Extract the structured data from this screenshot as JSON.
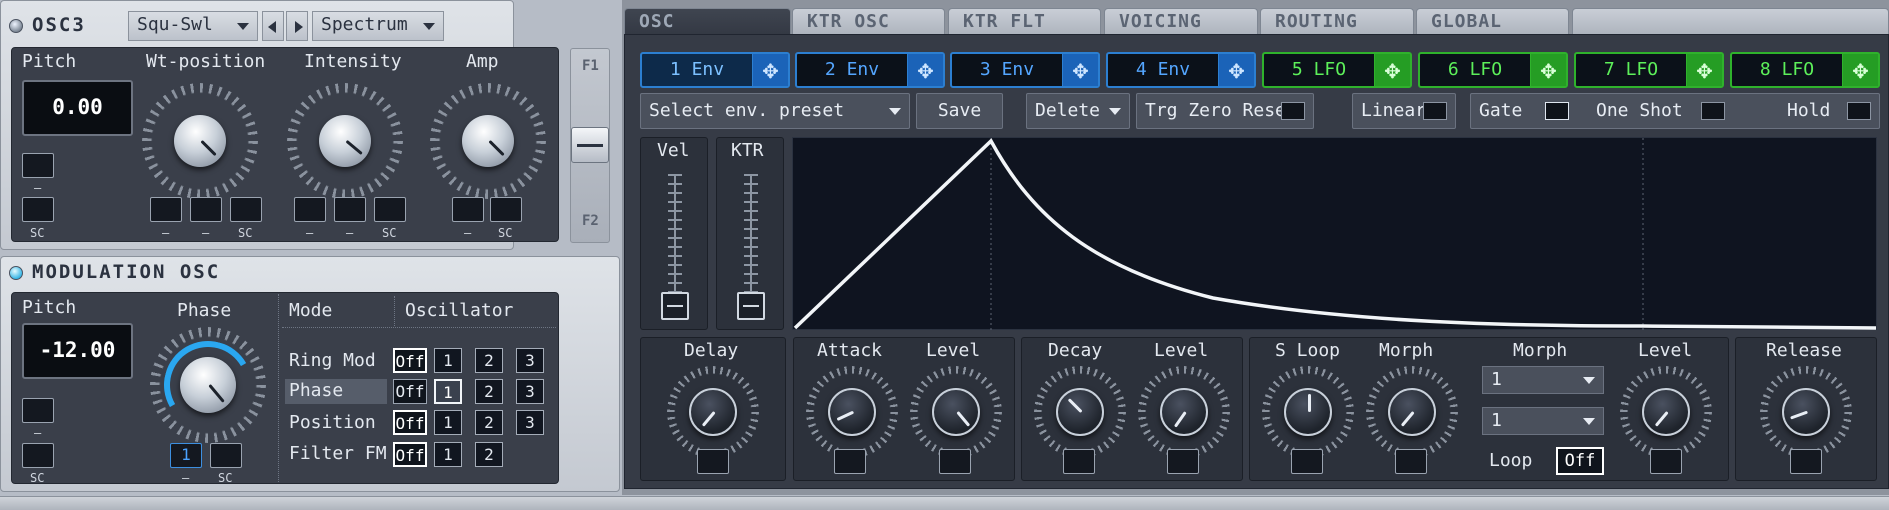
{
  "osc3": {
    "title": "OSC3",
    "wavetable": "Squ-Swl",
    "mode": "Spectrum",
    "knob_labels": [
      "Pitch",
      "Wt-position",
      "Intensity",
      "Amp"
    ],
    "pitch_value": "0.00",
    "mod_labels": [
      "–",
      "SC",
      "–",
      "–",
      "SC",
      "–",
      "–",
      "SC",
      "–",
      "SC"
    ],
    "filter_labels": [
      "F1",
      "F2"
    ]
  },
  "mod_osc": {
    "title": "MODULATION OSC",
    "pitch_label": "Pitch",
    "pitch_value": "-12.00",
    "phase_label": "Phase",
    "mode_header": "Mode",
    "osc_header": "Oscillator",
    "phase_mod_value": "1",
    "dash": "–",
    "sc": "SC",
    "rows": [
      {
        "name": "Ring Mod",
        "off": "Off",
        "opts": [
          "1",
          "2",
          "3"
        ]
      },
      {
        "name": "Phase",
        "off": "Off",
        "opts": [
          "1",
          "2",
          "3"
        ]
      },
      {
        "name": "Position",
        "off": "Off",
        "opts": [
          "1",
          "2",
          "3"
        ]
      },
      {
        "name": "Filter FM",
        "off": "Off",
        "opts": [
          "1",
          "2"
        ]
      }
    ]
  },
  "tabs": [
    "OSC",
    "KTR OSC",
    "KTR FLT",
    "VOICING",
    "ROUTING",
    "GLOBAL"
  ],
  "envs": [
    "1 Env",
    "2 Env",
    "3 Env",
    "4 Env",
    "5 LFO",
    "6 LFO",
    "7 LFO",
    "8 LFO"
  ],
  "toolbar": {
    "preset": "Select env. preset",
    "save": "Save",
    "delete": "Delete",
    "trg_zero_reset": "Trg Zero Reset",
    "linear": "Linear",
    "gate": "Gate",
    "one_shot": "One Shot",
    "hold": "Hold"
  },
  "sliders": {
    "vel": "Vel",
    "ktr": "KTR"
  },
  "env_knobs": {
    "delay": "Delay",
    "attack": "Attack",
    "attack_level": "Level",
    "decay": "Decay",
    "decay_level": "Level",
    "sloop": "S Loop",
    "morph": "Morph",
    "morph_header": "Morph",
    "morph_sel1": "1",
    "morph_sel2": "1",
    "loop_label": "Loop",
    "loop_value": "Off",
    "level": "Level",
    "release": "Release"
  }
}
